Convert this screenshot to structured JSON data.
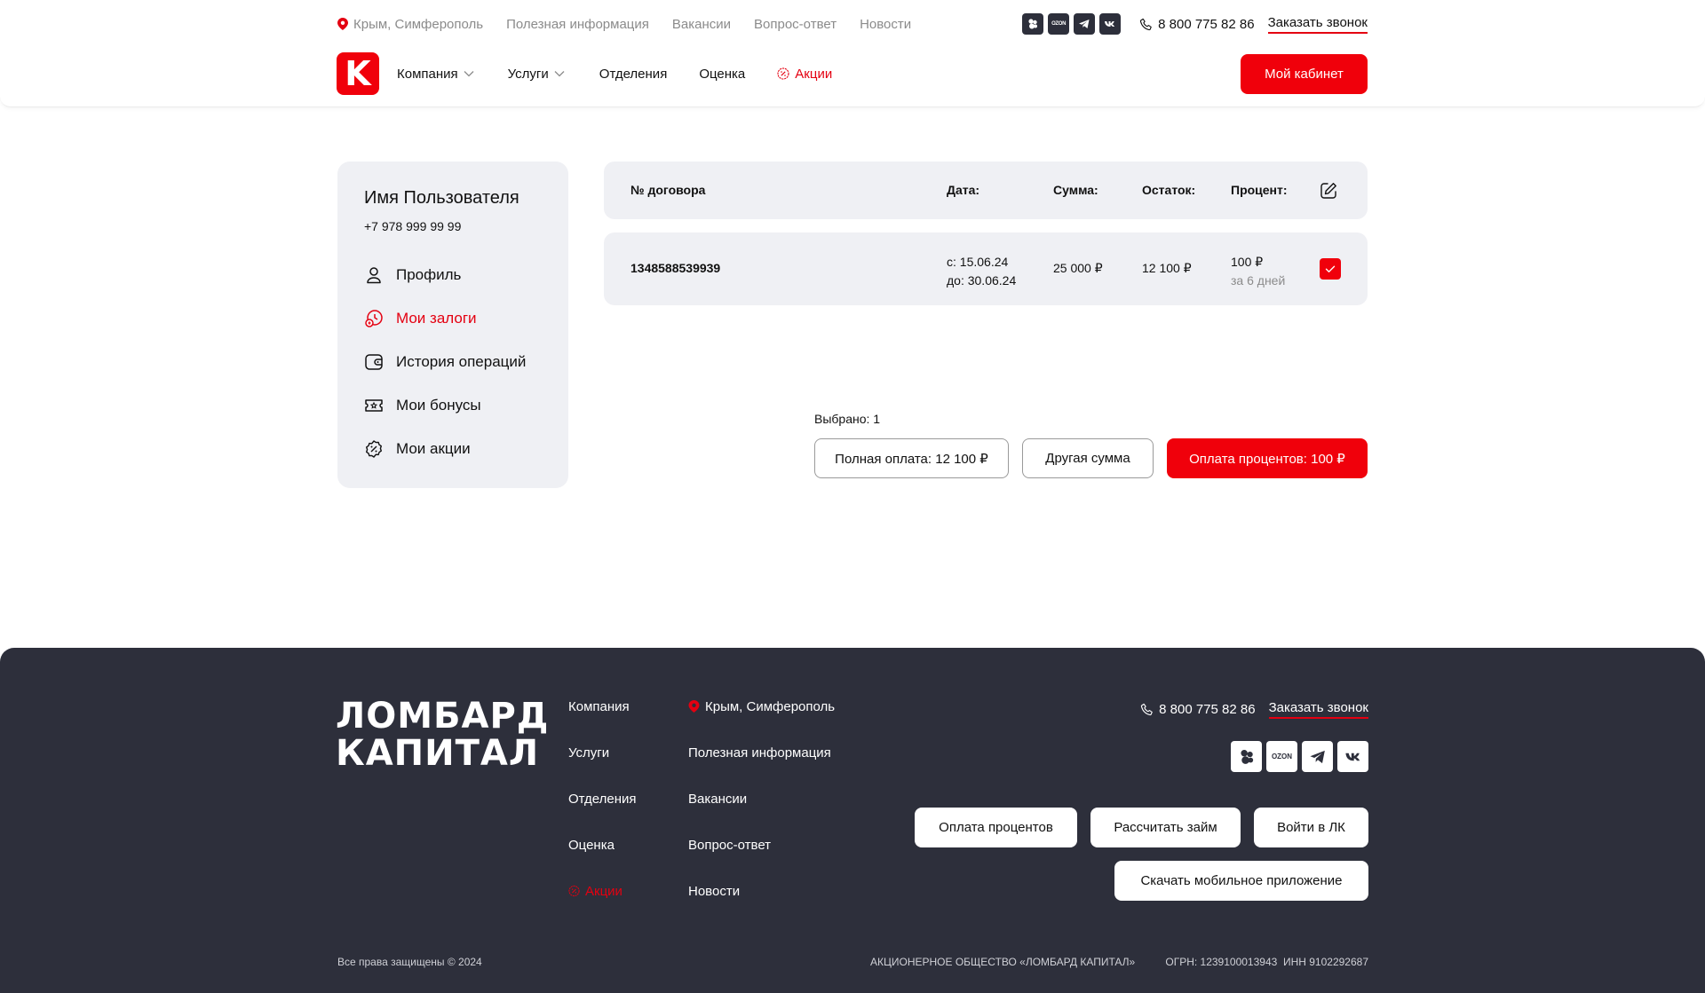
{
  "header": {
    "location": "Крым, Симферополь",
    "util_links": [
      "Полезная информация",
      "Вакансии",
      "Вопрос-ответ",
      "Новости"
    ],
    "socials": [
      "vk-clips-icon",
      "ozon-icon",
      "telegram-icon",
      "vk-icon"
    ],
    "ozon_label": "OZON",
    "phone": "8 800 775 82 86",
    "callback": "Заказать звонок",
    "logo_letter": "K",
    "nav": {
      "company": "Компания",
      "services": "Услуги",
      "branches": "Отделения",
      "valuation": "Оценка",
      "promos": "Акции"
    },
    "cabinet_button": "Мой кабинет"
  },
  "sidebar": {
    "user_name": "Имя Пользователя",
    "user_phone": "+7 978 999 99 99",
    "menu": [
      {
        "label": "Профиль",
        "icon": "user-icon"
      },
      {
        "label": "Мои залоги",
        "icon": "pledge-icon",
        "active": true
      },
      {
        "label": "История операций",
        "icon": "wallet-icon"
      },
      {
        "label": "Мои бонусы",
        "icon": "bonus-ticket-icon"
      },
      {
        "label": "Мои акции",
        "icon": "discount-badge-icon"
      }
    ]
  },
  "table": {
    "headers": {
      "contract": "№ договора",
      "date": "Дата:",
      "sum": "Сумма:",
      "remainder": "Остаток:",
      "percent": "Процент:"
    },
    "rows": [
      {
        "contract": "1348588539939",
        "date_from": "с: 15.06.24",
        "date_to": "до: 30.06.24",
        "sum": "25 000 ₽",
        "remainder": "12 100 ₽",
        "percent": "100 ₽",
        "percent_period": "за 6 дней",
        "checked": true
      }
    ]
  },
  "selection": {
    "selected_text": "Выбрано: 1",
    "full_payment": "Полная оплата: 12 100 ₽",
    "other_sum": "Другая сумма",
    "interest_payment": "Оплата процентов: 100 ₽"
  },
  "footer": {
    "brand_line1": "ЛОМБАРД",
    "brand_line2": "КАПИТАЛ",
    "col1": [
      "Компания",
      "Услуги",
      "Отделения",
      "Оценка",
      "Акции"
    ],
    "col2": [
      "Крым, Симферополь",
      "Полезная информация",
      "Вакансии",
      "Вопрос-ответ",
      "Новости"
    ],
    "phone": "8 800 775 82 86",
    "callback": "Заказать звонок",
    "buttons": [
      "Оплата процентов",
      "Рассчитать займ",
      "Войти в ЛК"
    ],
    "app_button": "Скачать мобильное приложение",
    "copyright": "Все права защищены © 2024",
    "company_name": "АКЦИОНЕРНОЕ ОБЩЕСТВО «ЛОМБАРД КАПИТАЛ»",
    "ogrn_inn": "ОГРН: 1239100013943  ИНН 9102292687"
  },
  "colors": {
    "accent": "#f0000b",
    "panel": "#eff0f4",
    "footer_bg": "#2d2f3b"
  }
}
